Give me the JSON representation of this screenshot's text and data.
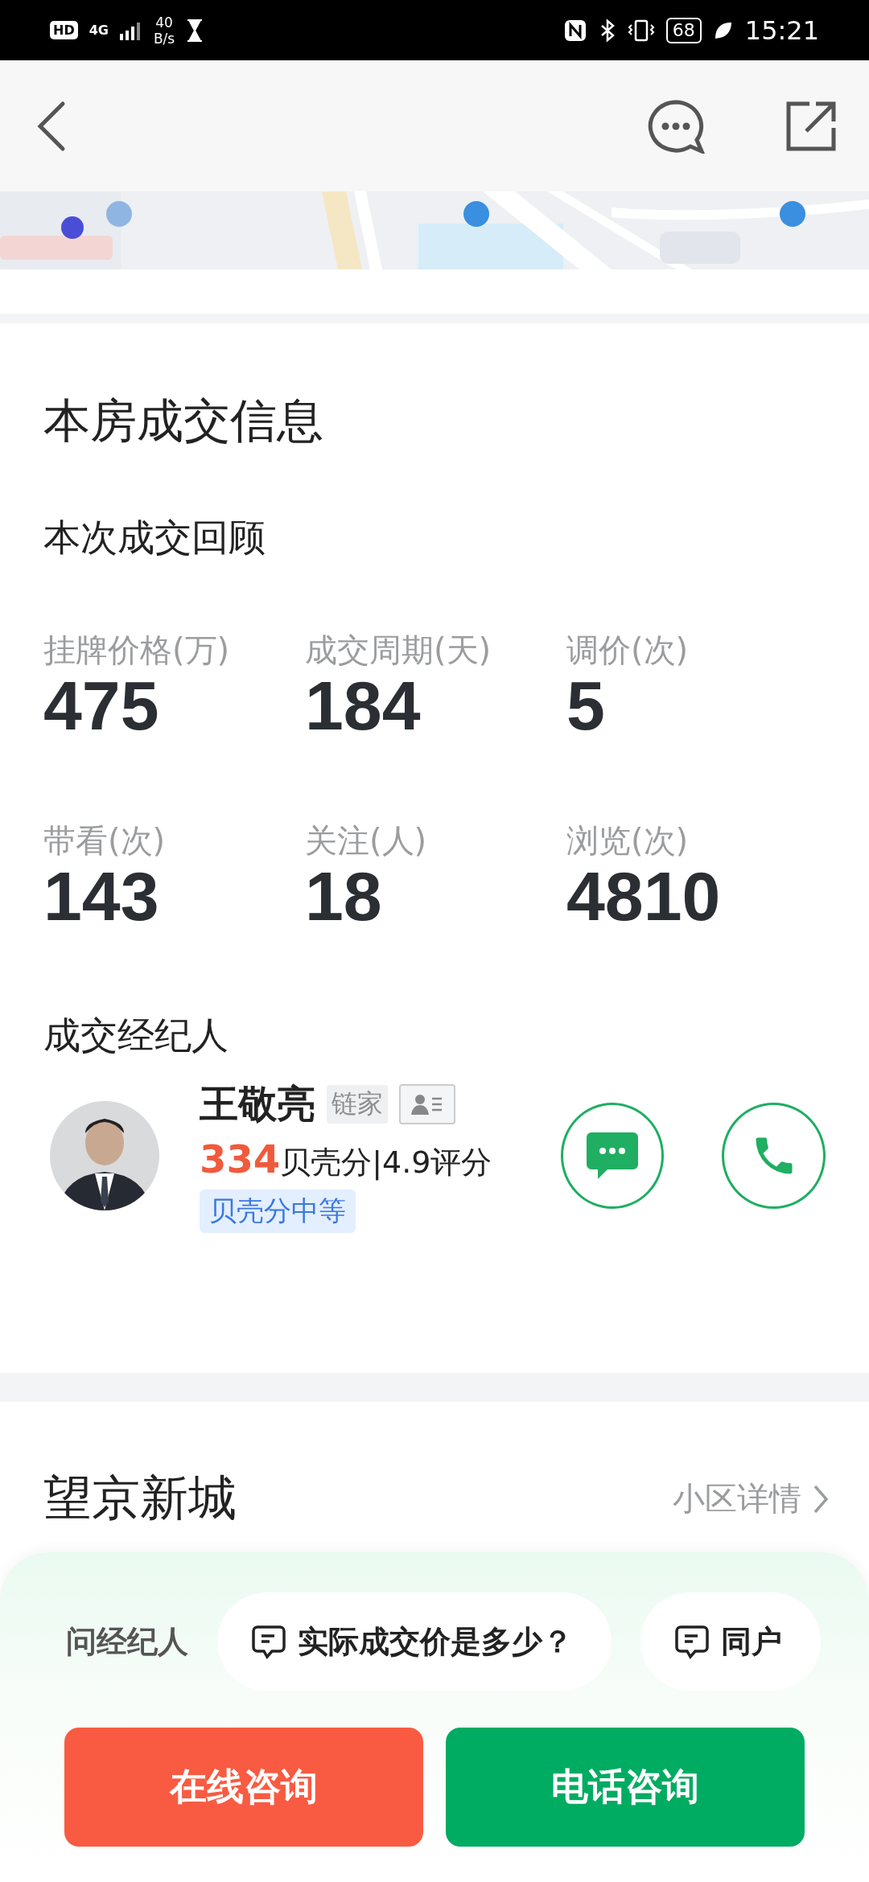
{
  "status_bar": {
    "hd": "HD",
    "network": "4G",
    "speed": "40",
    "speed_unit": "B/s",
    "battery": "68",
    "time": "15:21"
  },
  "deal_info": {
    "title": "本房成交信息",
    "subtitle": "本次成交回顾",
    "stats": [
      {
        "label": "挂牌价格(万)",
        "value": "475"
      },
      {
        "label": "成交周期(天)",
        "value": "184"
      },
      {
        "label": "调价(次)",
        "value": "5"
      },
      {
        "label": "带看(次)",
        "value": "143"
      },
      {
        "label": "关注(人)",
        "value": "18"
      },
      {
        "label": "浏览(次)",
        "value": "4810"
      }
    ],
    "agent_section_title": "成交经纪人",
    "agent": {
      "name": "王敬亮",
      "brand": "链家",
      "score": "334",
      "score_text": "贝壳分|4.9评分",
      "tag": "贝壳分中等"
    }
  },
  "community": {
    "name": "望京新城",
    "link": "小区详情"
  },
  "ask": {
    "label": "问经纪人",
    "questions": [
      "实际成交价是多少？",
      "同户"
    ]
  },
  "actions": [
    {
      "label": "在线咨询",
      "kind": "online"
    },
    {
      "label": "电话咨询",
      "kind": "phone"
    }
  ]
}
